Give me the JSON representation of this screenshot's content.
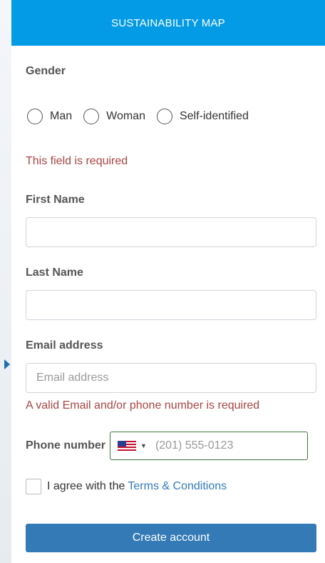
{
  "header": {
    "title": "SUSTAINABILITY MAP"
  },
  "gender": {
    "label": "Gender",
    "options": [
      "Man",
      "Woman",
      "Self-identified"
    ],
    "error": "This field is required"
  },
  "first_name": {
    "label": "First Name",
    "value": "",
    "placeholder": ""
  },
  "last_name": {
    "label": "Last Name",
    "value": "",
    "placeholder": ""
  },
  "email": {
    "label": "Email address",
    "placeholder": "Email address",
    "error": "A valid Email and/or phone number is required"
  },
  "phone": {
    "label": "Phone number",
    "country": "US",
    "placeholder": "(201) 555-0123"
  },
  "agree": {
    "text": "I agree with the",
    "link": "Terms & Conditions"
  },
  "submit": {
    "label": "Create account"
  },
  "colors": {
    "header": "#039be5",
    "button": "#337ab7",
    "error": "#a94442",
    "link": "#337ab7"
  }
}
